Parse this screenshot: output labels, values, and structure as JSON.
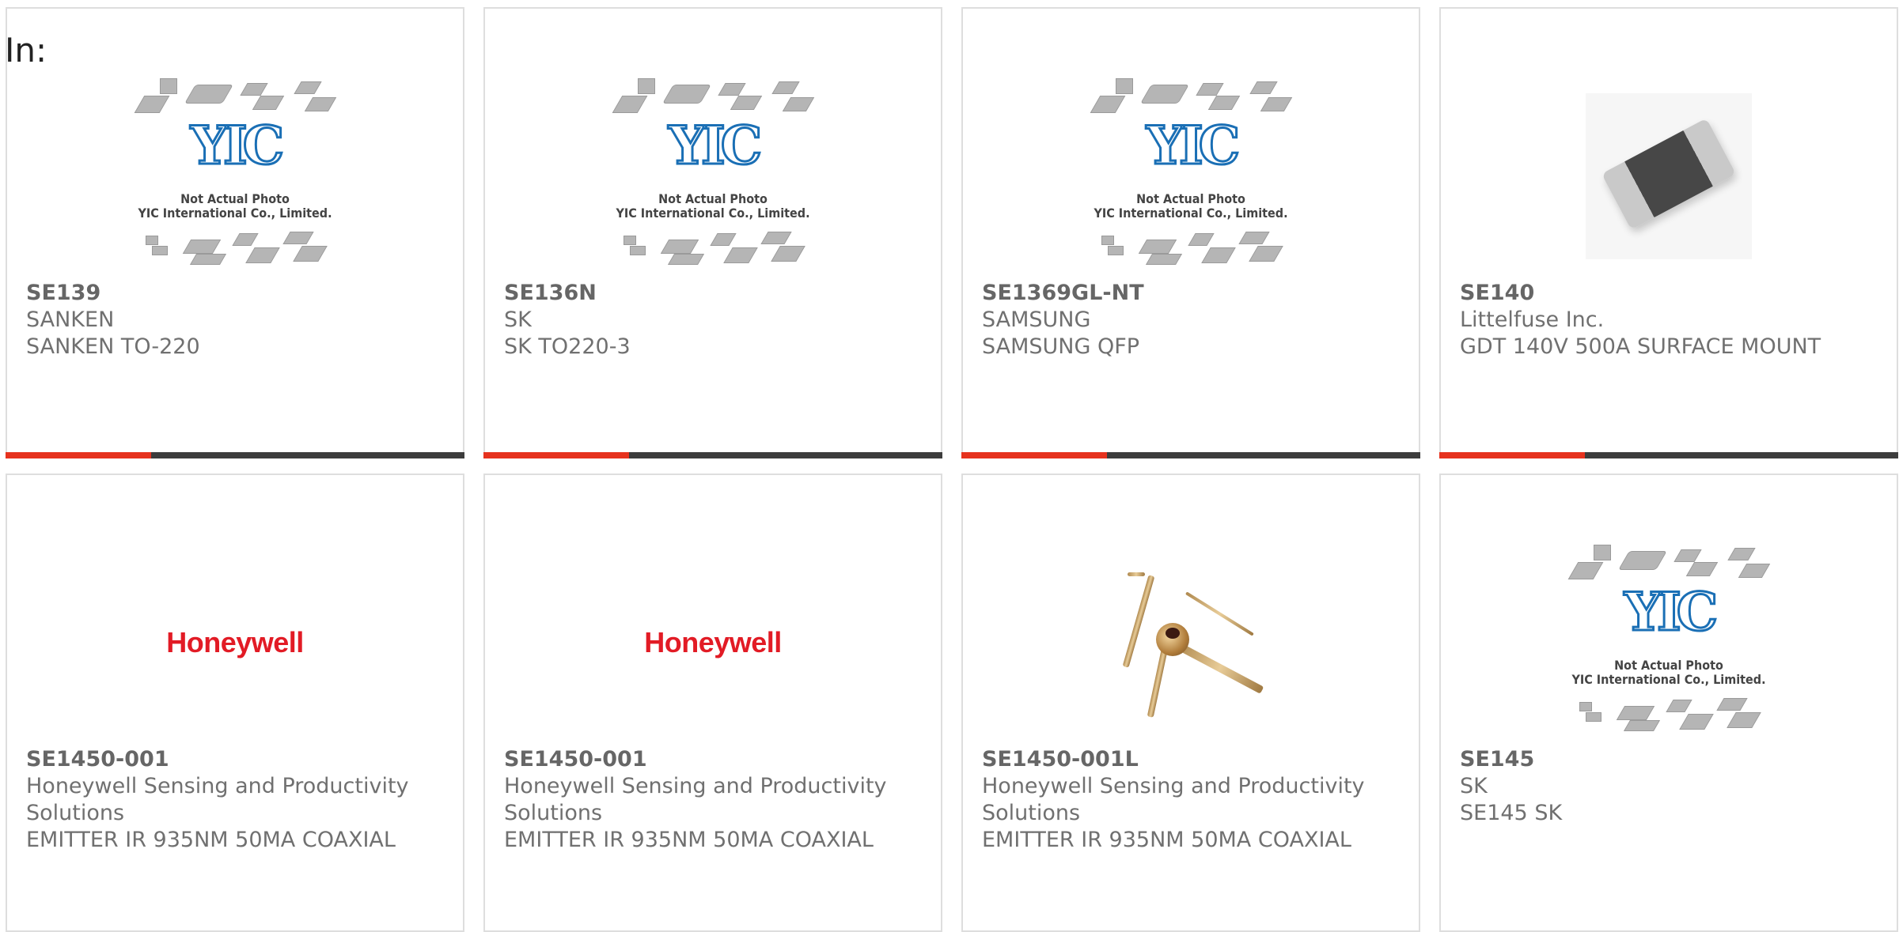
{
  "page": {
    "in_label": "In:"
  },
  "placeholder": {
    "logo_text": "YIC",
    "caption_line1": "Not Actual Photo",
    "caption_line2": "YIC International Co., Limited."
  },
  "brand": {
    "honeywell_logo_text": "Honeywell"
  },
  "colors": {
    "accent_bar": "#e6321e",
    "bar": "#3c3c3c",
    "honeywell": "#e21b25"
  },
  "products": [
    {
      "part": "SE139",
      "manufacturer": "SANKEN",
      "description": "SANKEN TO-220",
      "image": "yic-placeholder"
    },
    {
      "part": "SE136N",
      "manufacturer": "SK",
      "description": "SK TO220-3",
      "image": "yic-placeholder"
    },
    {
      "part": "SE1369GL-NT",
      "manufacturer": "SAMSUNG",
      "description": "SAMSUNG QFP",
      "image": "yic-placeholder"
    },
    {
      "part": "SE140",
      "manufacturer": "Littelfuse Inc.",
      "description": "GDT 140V 500A SURFACE MOUNT",
      "image": "smd-component-photo"
    },
    {
      "part": "SE1450-001",
      "manufacturer": "Honeywell Sensing and Productivity Solutions",
      "description": "EMITTER IR 935NM 50MA COAXIAL",
      "image": "honeywell-logo"
    },
    {
      "part": "SE1450-001",
      "manufacturer": "Honeywell Sensing and Productivity Solutions",
      "description": "EMITTER IR 935NM 50MA COAXIAL",
      "image": "honeywell-logo"
    },
    {
      "part": "SE1450-001L",
      "manufacturer": "Honeywell Sensing and Productivity Solutions",
      "description": "EMITTER IR 935NM 50MA COAXIAL",
      "image": "ir-emitter-photo"
    },
    {
      "part": "SE145",
      "manufacturer": "SK",
      "description": "SE145 SK",
      "image": "yic-placeholder"
    }
  ]
}
